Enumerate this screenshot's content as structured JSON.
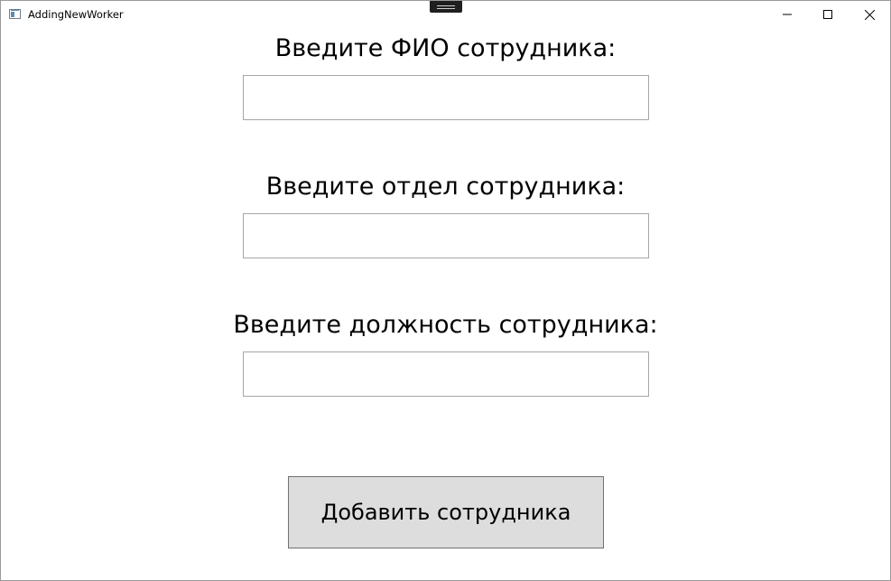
{
  "window": {
    "title": "AddingNewWorker"
  },
  "icons": {
    "app": "app-window-icon",
    "drag": "drag-handle-icon",
    "minimize": "minimize-icon",
    "maximize": "maximize-icon",
    "close": "close-icon"
  },
  "form": {
    "fio_label": "Введите ФИО сотрудника:",
    "fio_value": "",
    "department_label": "Введите отдел сотрудника:",
    "department_value": "",
    "position_label": "Введите должность сотрудника:",
    "position_value": "",
    "add_button_label": "Добавить сотрудника"
  },
  "colors": {
    "button_background": "#dddddd",
    "field_border": "#a6a6a6",
    "button_border": "#707070"
  }
}
